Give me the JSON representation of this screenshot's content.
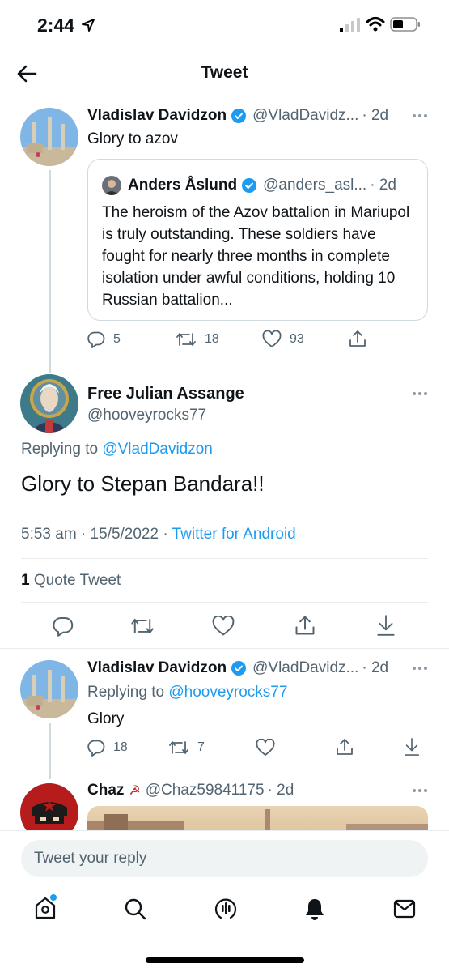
{
  "status_bar": {
    "time": "2:44",
    "location_icon": "location-arrow-icon",
    "signal_icon": "cellular-signal-icon",
    "wifi_icon": "wifi-icon",
    "battery_icon": "battery-icon"
  },
  "header": {
    "title": "Tweet",
    "back_icon": "back-arrow-icon"
  },
  "parent_tweet": {
    "name": "Vladislav Davidzon",
    "handle": "@VladDavidz...",
    "time": "· 2d",
    "text": "Glory to azov",
    "quote": {
      "name": "Anders Åslund",
      "handle": "@anders_asl...",
      "time": "· 2d",
      "text": "The heroism of the Azov battalion in Mariupol is truly outstanding. These soldiers have fought for nearly three months in complete isolation under awful conditions, holding 10 Russian battalion..."
    },
    "replies": "5",
    "retweets": "18",
    "likes": "93"
  },
  "main_tweet": {
    "name": "Free Julian Assange",
    "handle": "@hooveyrocks77",
    "replying_prefix": "Replying to",
    "replying_to": "@VladDavidzon",
    "text": "Glory to Stepan Bandara!!",
    "timestamp": "5:53 am · 15/5/2022 ·",
    "source": "Twitter for Android",
    "quote_count": "1",
    "quote_label": "Quote Tweet"
  },
  "reply_tweet": {
    "name": "Vladislav Davidzon",
    "handle": "@VladDavidz...",
    "time": "· 2d",
    "replying_prefix": "Replying to",
    "replying_to": "@hooveyrocks77",
    "text": "Glory",
    "replies": "18",
    "retweets": "7"
  },
  "next_tweet": {
    "name": "Chaz",
    "emoji": "☭",
    "handle": "@Chaz59841175",
    "time": "· 2d"
  },
  "composer": {
    "placeholder": "Tweet your reply"
  },
  "colors": {
    "accent": "#1d9bf0",
    "text_secondary": "#536471",
    "divider": "#e6ecf0"
  }
}
